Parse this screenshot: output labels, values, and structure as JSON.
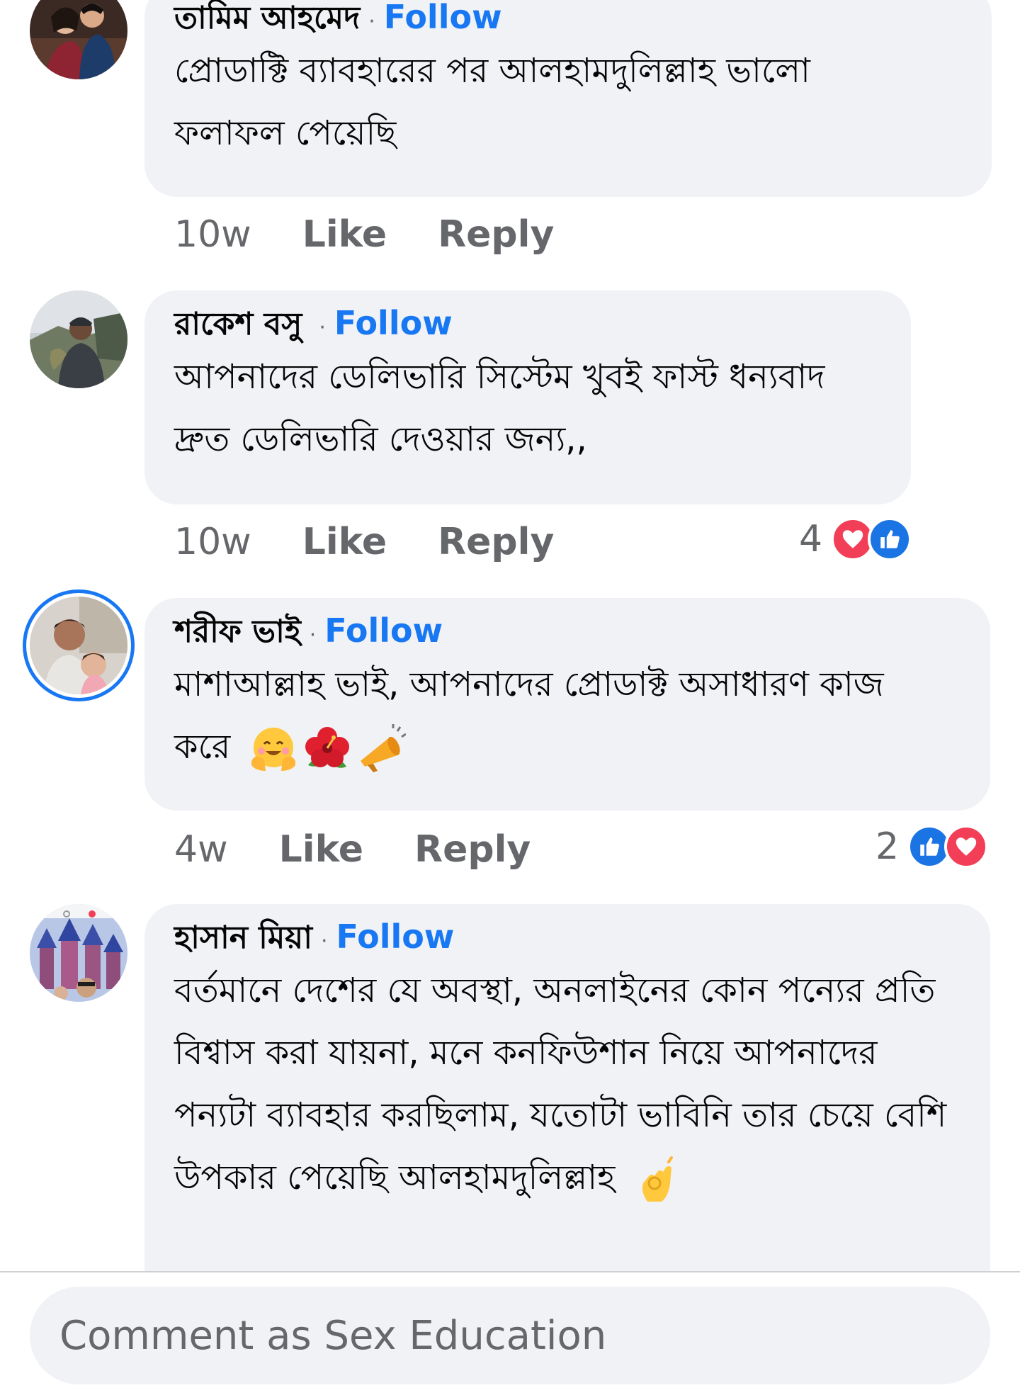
{
  "comments": [
    {
      "author": "তামিম আহমেদ",
      "separator": "·",
      "follow_label": "Follow",
      "text": "প্রোডাক্টি ব্যাবহারের পর আলহামদুলিল্লাহ ভালো ফলাফল পেয়েছি",
      "time": "10w",
      "like_label": "Like",
      "reply_label": "Reply",
      "avatar_icon": "couple-photo-avatar"
    },
    {
      "author": "রাকেশ বসু",
      "separator": "·",
      "follow_label": "Follow",
      "text": "আপনাদের ডেলিভারি সিস্টেম খুবই ফাস্ট ধন্যবাদ দ্রুত ডেলিভারি দেওয়ার জন্য,,",
      "time": "10w",
      "like_label": "Like",
      "reply_label": "Reply",
      "reaction_count": "4",
      "reaction_icons": [
        "love-reaction-icon",
        "like-reaction-icon"
      ],
      "avatar_icon": "man-with-fish-avatar"
    },
    {
      "author": "শরীফ ভাই",
      "separator": "·",
      "follow_label": "Follow",
      "text": "মাশাআল্লাহ ভাই, আপনাদের প্রোডাক্ট অসাধারণ কাজ করে",
      "emojis": [
        "hugging-face-emoji",
        "hibiscus-emoji",
        "megaphone-emoji"
      ],
      "time": "4w",
      "like_label": "Like",
      "reply_label": "Reply",
      "reaction_count": "2",
      "reaction_icons": [
        "like-reaction-icon",
        "love-reaction-icon"
      ],
      "avatar_icon": "father-child-avatar",
      "avatar_has_story_ring": true
    },
    {
      "author": "হাসান মিয়া",
      "separator": "·",
      "follow_label": "Follow",
      "text": "বর্তমানে দেশের যে অবস্থা, অনলাইনের কোন পন্যের প্রতি বিশ্বাস করা যায়না, মনে কনফিউশান নিয়ে আপনাদের পন্যটা ব্যাবহার করছিলাম, যতোটা ভাবিনি তার চেয়ে বেশি উপকার পেয়েছি আলহামদুলিল্লাহ",
      "emojis": [
        "ok-hand-emoji"
      ],
      "avatar_icon": "castle-selfie-avatar"
    }
  ],
  "composer": {
    "placeholder": "Comment as Sex Education"
  },
  "colors": {
    "bubble": "#f0f2f5",
    "follow": "#1877f2",
    "meta": "#65676b",
    "love": "#f33e58",
    "like": "#1b74e4"
  }
}
